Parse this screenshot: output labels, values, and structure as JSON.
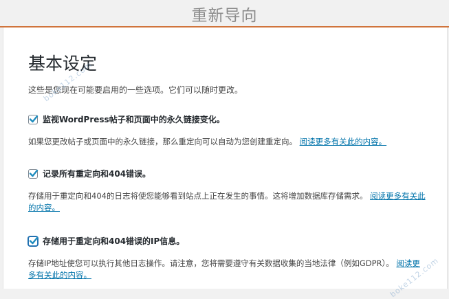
{
  "header": {
    "title": "重新导向"
  },
  "section": {
    "heading": "基本设定",
    "intro": "这些是您现在可能要启用的一些选项。它们可以随时更改。"
  },
  "options": [
    {
      "label": "监视WordPress帖子和页面中的永久链接变化。",
      "checked": true,
      "description": "如果您更改帖子或页面中的永久链接，那么重定向可以自动为您创建重定向。",
      "link": "阅读更多有关此的内容。"
    },
    {
      "label": "记录所有重定向和404错误。",
      "checked": true,
      "description": "存储用于重定向和404的日志将使您能够看到站点上正在发生的事情。这将增加数据库存储需求。",
      "link": "阅读更多有关此的内容。"
    },
    {
      "label": "存储用于重定向和404错误的IP信息。",
      "checked": true,
      "description": "存储IP地址使您可以执行其他日志操作。请注意，您将需要遵守有关数据收集的当地法律（例如GDPR）。",
      "link": "阅读更多有关此的内容。"
    }
  ],
  "watermark": "boke112.com"
}
